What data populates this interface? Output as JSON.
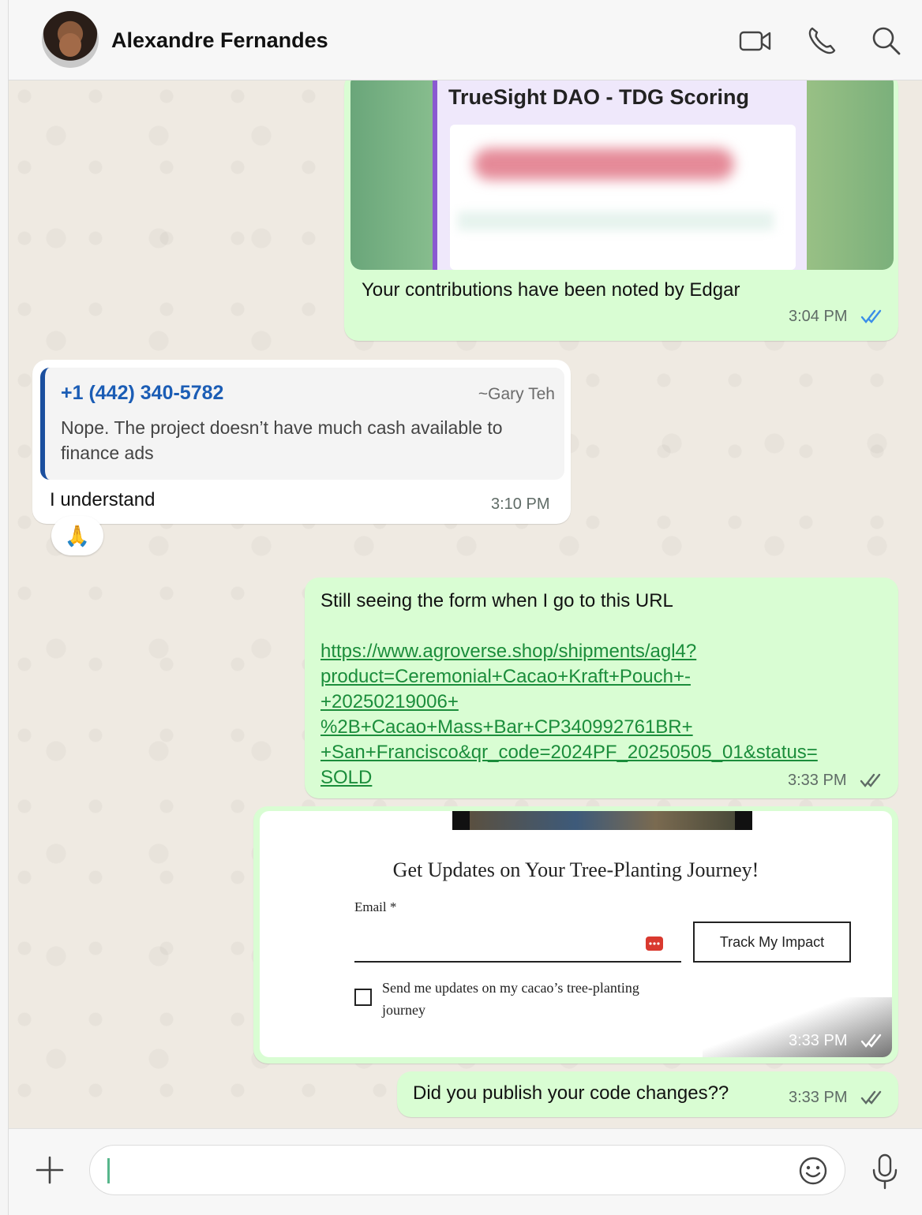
{
  "header": {
    "contact_name": "Alexandre Fernandes",
    "icons": [
      "video-call-icon",
      "voice-call-icon",
      "search-icon"
    ]
  },
  "messages": {
    "m1": {
      "preview_title": "TrueSight DAO - TDG Scoring",
      "text": "Your contributions have been noted by Edgar",
      "time": "3:04 PM",
      "status": "read"
    },
    "m2": {
      "quote_sender": "+1 (442) 340-5782",
      "quote_name": "~Gary Teh",
      "quote_text": "Nope. The project doesn’t have much cash available to finance ads",
      "text": "I understand",
      "time": "3:10 PM",
      "reaction": "🙏"
    },
    "m3": {
      "text": "Still seeing the form when I go to this URL",
      "link": "https://www.agroverse.shop/shipments/agl4?product=Ceremonial+Cacao+Kraft+Pouch+-+20250219006+%2B+Cacao+Mass+Bar+CP340992761BR++San+Francisco&qr_code=2024PF_20250505_01&status=SOLD",
      "link_lines": [
        "https://www.agroverse.shop/shipments/agl4?",
        "product=Ceremonial+Cacao+Kraft+Pouch+-",
        "+20250219006+",
        "%2B+Cacao+Mass+Bar+CP340992761BR+",
        "+San+Francisco&qr_code=2024PF_20250505_01&status=",
        "SOLD"
      ],
      "time": "3:33 PM",
      "status": "delivered"
    },
    "m4": {
      "form_title": "Get Updates on Your Tree-Planting Journey!",
      "email_label": "Email *",
      "button_label": "Track My Impact",
      "checkbox_label_1": "Send me updates on my cacao’s tree-planting",
      "checkbox_label_2": "journey",
      "time": "3:33 PM",
      "status": "delivered"
    },
    "m5": {
      "text": "Did you publish your code changes??",
      "time": "3:33 PM",
      "status": "delivered"
    }
  },
  "composer": {
    "placeholder": ""
  },
  "colors": {
    "outgoing": "#d9fdd3",
    "incoming": "#ffffff",
    "read_tick": "#3b8ee8",
    "link": "#1b8d3b"
  }
}
